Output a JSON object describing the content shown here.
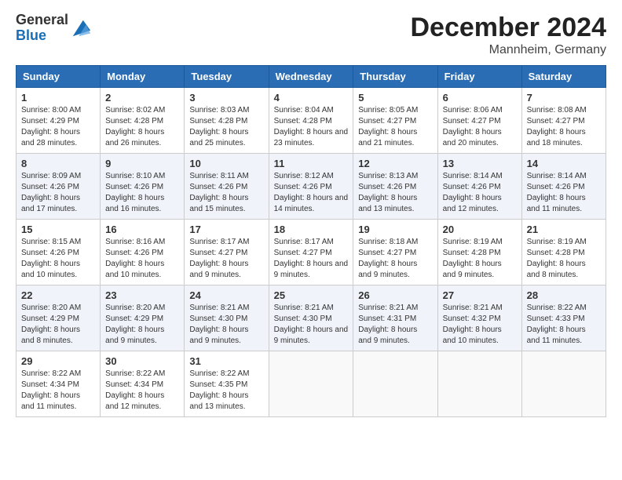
{
  "header": {
    "logo_general": "General",
    "logo_blue": "Blue",
    "month_title": "December 2024",
    "location": "Mannheim, Germany"
  },
  "days_of_week": [
    "Sunday",
    "Monday",
    "Tuesday",
    "Wednesday",
    "Thursday",
    "Friday",
    "Saturday"
  ],
  "weeks": [
    [
      {
        "day": "1",
        "sunrise": "8:00 AM",
        "sunset": "4:29 PM",
        "daylight": "8 hours and 28 minutes."
      },
      {
        "day": "2",
        "sunrise": "8:02 AM",
        "sunset": "4:28 PM",
        "daylight": "8 hours and 26 minutes."
      },
      {
        "day": "3",
        "sunrise": "8:03 AM",
        "sunset": "4:28 PM",
        "daylight": "8 hours and 25 minutes."
      },
      {
        "day": "4",
        "sunrise": "8:04 AM",
        "sunset": "4:28 PM",
        "daylight": "8 hours and 23 minutes."
      },
      {
        "day": "5",
        "sunrise": "8:05 AM",
        "sunset": "4:27 PM",
        "daylight": "8 hours and 21 minutes."
      },
      {
        "day": "6",
        "sunrise": "8:06 AM",
        "sunset": "4:27 PM",
        "daylight": "8 hours and 20 minutes."
      },
      {
        "day": "7",
        "sunrise": "8:08 AM",
        "sunset": "4:27 PM",
        "daylight": "8 hours and 18 minutes."
      }
    ],
    [
      {
        "day": "8",
        "sunrise": "8:09 AM",
        "sunset": "4:26 PM",
        "daylight": "8 hours and 17 minutes."
      },
      {
        "day": "9",
        "sunrise": "8:10 AM",
        "sunset": "4:26 PM",
        "daylight": "8 hours and 16 minutes."
      },
      {
        "day": "10",
        "sunrise": "8:11 AM",
        "sunset": "4:26 PM",
        "daylight": "8 hours and 15 minutes."
      },
      {
        "day": "11",
        "sunrise": "8:12 AM",
        "sunset": "4:26 PM",
        "daylight": "8 hours and 14 minutes."
      },
      {
        "day": "12",
        "sunrise": "8:13 AM",
        "sunset": "4:26 PM",
        "daylight": "8 hours and 13 minutes."
      },
      {
        "day": "13",
        "sunrise": "8:14 AM",
        "sunset": "4:26 PM",
        "daylight": "8 hours and 12 minutes."
      },
      {
        "day": "14",
        "sunrise": "8:14 AM",
        "sunset": "4:26 PM",
        "daylight": "8 hours and 11 minutes."
      }
    ],
    [
      {
        "day": "15",
        "sunrise": "8:15 AM",
        "sunset": "4:26 PM",
        "daylight": "8 hours and 10 minutes."
      },
      {
        "day": "16",
        "sunrise": "8:16 AM",
        "sunset": "4:26 PM",
        "daylight": "8 hours and 10 minutes."
      },
      {
        "day": "17",
        "sunrise": "8:17 AM",
        "sunset": "4:27 PM",
        "daylight": "8 hours and 9 minutes."
      },
      {
        "day": "18",
        "sunrise": "8:17 AM",
        "sunset": "4:27 PM",
        "daylight": "8 hours and 9 minutes."
      },
      {
        "day": "19",
        "sunrise": "8:18 AM",
        "sunset": "4:27 PM",
        "daylight": "8 hours and 9 minutes."
      },
      {
        "day": "20",
        "sunrise": "8:19 AM",
        "sunset": "4:28 PM",
        "daylight": "8 hours and 9 minutes."
      },
      {
        "day": "21",
        "sunrise": "8:19 AM",
        "sunset": "4:28 PM",
        "daylight": "8 hours and 8 minutes."
      }
    ],
    [
      {
        "day": "22",
        "sunrise": "8:20 AM",
        "sunset": "4:29 PM",
        "daylight": "8 hours and 8 minutes."
      },
      {
        "day": "23",
        "sunrise": "8:20 AM",
        "sunset": "4:29 PM",
        "daylight": "8 hours and 9 minutes."
      },
      {
        "day": "24",
        "sunrise": "8:21 AM",
        "sunset": "4:30 PM",
        "daylight": "8 hours and 9 minutes."
      },
      {
        "day": "25",
        "sunrise": "8:21 AM",
        "sunset": "4:30 PM",
        "daylight": "8 hours and 9 minutes."
      },
      {
        "day": "26",
        "sunrise": "8:21 AM",
        "sunset": "4:31 PM",
        "daylight": "8 hours and 9 minutes."
      },
      {
        "day": "27",
        "sunrise": "8:21 AM",
        "sunset": "4:32 PM",
        "daylight": "8 hours and 10 minutes."
      },
      {
        "day": "28",
        "sunrise": "8:22 AM",
        "sunset": "4:33 PM",
        "daylight": "8 hours and 11 minutes."
      }
    ],
    [
      {
        "day": "29",
        "sunrise": "8:22 AM",
        "sunset": "4:34 PM",
        "daylight": "8 hours and 11 minutes."
      },
      {
        "day": "30",
        "sunrise": "8:22 AM",
        "sunset": "4:34 PM",
        "daylight": "8 hours and 12 minutes."
      },
      {
        "day": "31",
        "sunrise": "8:22 AM",
        "sunset": "4:35 PM",
        "daylight": "8 hours and 13 minutes."
      },
      null,
      null,
      null,
      null
    ]
  ]
}
